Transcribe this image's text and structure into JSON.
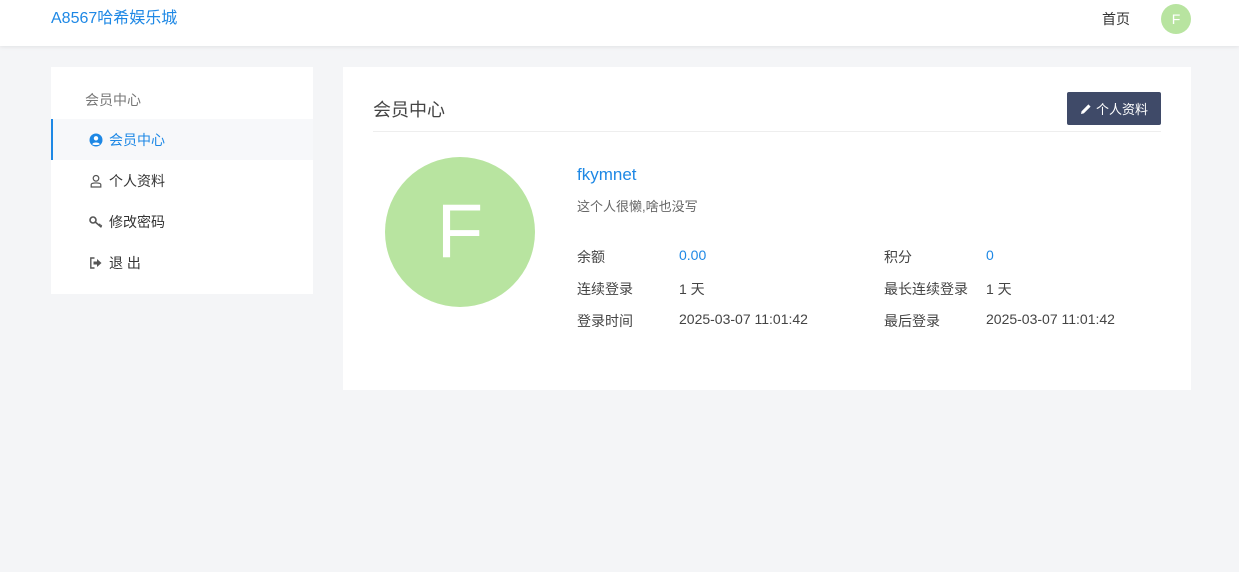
{
  "header": {
    "brand": "A8567哈希娱乐城",
    "home_link": "首页",
    "avatar_letter": "F"
  },
  "sidebar": {
    "title": "会员中心",
    "items": [
      {
        "label": "会员中心",
        "icon": "user-circle-icon",
        "active": true
      },
      {
        "label": "个人资料",
        "icon": "user-outline-icon",
        "active": false
      },
      {
        "label": "修改密码",
        "icon": "key-icon",
        "active": false
      },
      {
        "label": "退 出",
        "icon": "sign-out-icon",
        "active": false
      }
    ]
  },
  "main": {
    "title": "会员中心",
    "profile_button": "个人资料",
    "profile_button_icon": "pencil-icon",
    "avatar_letter": "F",
    "username": "fkymnet",
    "bio": "这个人很懒,啥也没写",
    "stats": {
      "balance_label": "余额",
      "balance_value": "0.00",
      "points_label": "积分",
      "points_value": "0",
      "consecutive_login_label": "连续登录",
      "consecutive_login_value": "1 天",
      "longest_consecutive_label": "最长连续登录",
      "longest_consecutive_value": "1 天",
      "login_time_label": "登录时间",
      "login_time_value": "2025-03-07 11:01:42",
      "last_login_label": "最后登录",
      "last_login_value": "2025-03-07 11:01:42"
    }
  },
  "colors": {
    "accent": "#1e88e5",
    "avatar_bg": "#b8e4a0",
    "button_bg": "#3f4a68",
    "page_bg": "#f4f5f7"
  }
}
